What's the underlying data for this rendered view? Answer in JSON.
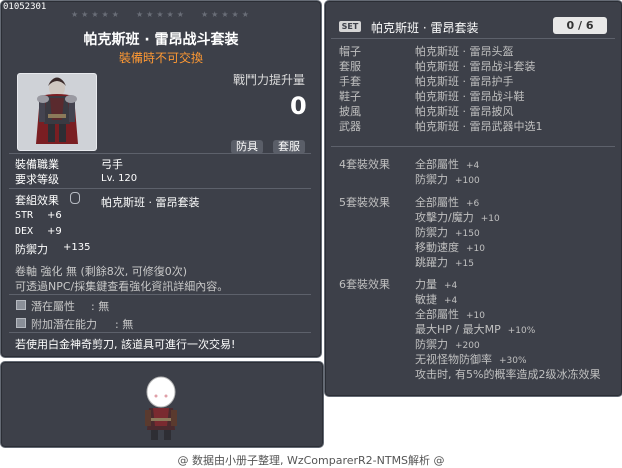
{
  "item": {
    "id": "01052301",
    "stars": [
      "★★★★★",
      "★★★★★",
      "★★★★★"
    ],
    "title": "帕克斯班 · 雷昂战斗套装",
    "notice": "裝備時不可交換",
    "power_label": "戰鬥力提升量",
    "power_value": "0",
    "tags": [
      "防具",
      "套服"
    ],
    "job_label": "裝備職業",
    "job_value": "弓手",
    "level_label": "要求等级",
    "level_value": "Lv. 120",
    "set_effect_label": "套組效果",
    "set_effect_value": "帕克斯班 · 雷昂套装",
    "stats": [
      {
        "name": "STR",
        "value": "+6"
      },
      {
        "name": "DEX",
        "value": "+9"
      },
      {
        "name": "防禦力",
        "value": "+135"
      }
    ],
    "scroll_line": "卷軸 強化 無 (剩餘8次, 可修復0次)",
    "npc_line": "可透過NPC/採集鍵查看強化資訊詳細內容。",
    "potential": {
      "label": "潛在屬性",
      "value": ": 無"
    },
    "bonus_potential": {
      "label": "附加潛在能力",
      "value": ": 無"
    },
    "trade_notice": "若使用白金神奇剪刀, 該道具可進行一次交易!"
  },
  "set": {
    "badge": "SET",
    "name": "帕克斯班 · 雷昂套装",
    "count": "0 / 6",
    "pieces": [
      {
        "slot": "帽子",
        "name": "帕克斯班 · 雷昂头盔"
      },
      {
        "slot": "套服",
        "name": "帕克斯班 · 雷昂战斗套装"
      },
      {
        "slot": "手套",
        "name": "帕克斯班 · 雷昂护手"
      },
      {
        "slot": "鞋子",
        "name": "帕克斯班 · 雷昂战斗鞋"
      },
      {
        "slot": "披風",
        "name": "帕克斯班 · 雷昂披风"
      },
      {
        "slot": "武器",
        "name": "帕克斯班 · 雷昂武器中选1"
      }
    ],
    "effects": [
      {
        "head": "4套裝效果",
        "lines": [
          {
            "text": "全部屬性",
            "num": "+4"
          },
          {
            "text": "防禦力",
            "num": "+100"
          }
        ]
      },
      {
        "head": "5套裝效果",
        "lines": [
          {
            "text": "全部屬性",
            "num": "+6"
          },
          {
            "text": "攻擊力/魔力",
            "num": "+10"
          },
          {
            "text": "防禦力",
            "num": "+150"
          },
          {
            "text": "移動速度",
            "num": "+10"
          },
          {
            "text": "跳躍力",
            "num": "+15"
          }
        ]
      },
      {
        "head": "6套裝效果",
        "lines": [
          {
            "text": "力量",
            "num": "+4"
          },
          {
            "text": "敏捷",
            "num": "+4"
          },
          {
            "text": "全部屬性",
            "num": "+10"
          },
          {
            "text": "最大HP / 最大MP",
            "num": "+10%"
          },
          {
            "text": "防禦力",
            "num": "+200"
          },
          {
            "text": "无视怪物防御率",
            "num": "+30%"
          },
          {
            "text": "攻击时, 有5%的概率造成2级冰冻效果",
            "num": ""
          }
        ]
      }
    ]
  },
  "footer": "@ 数据由小册子整理, WzComparerR2-NTMS解析 @",
  "colors": {
    "panel": "#3d4049",
    "notice": "#ff9933",
    "text": "#ffffff",
    "muted": "#c0c0c0"
  }
}
